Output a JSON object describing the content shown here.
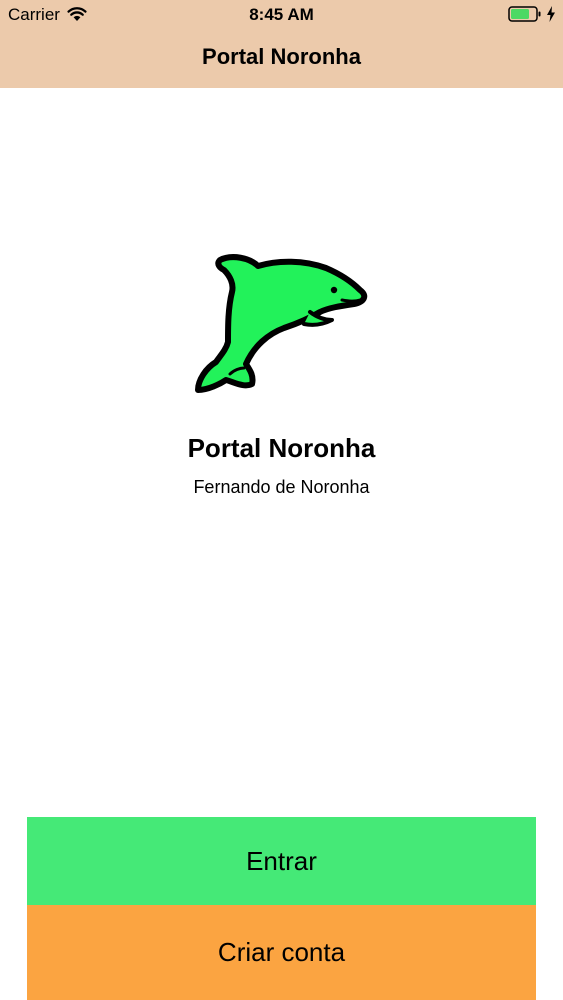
{
  "status_bar": {
    "carrier": "Carrier",
    "time": "8:45 AM",
    "icons": [
      "wifi-icon",
      "battery-icon",
      "charging-icon"
    ]
  },
  "nav": {
    "title": "Portal Noronha"
  },
  "main": {
    "logo_icon": "dolphin-logo",
    "title": "Portal Noronha",
    "subtitle": "Fernando de Noronha"
  },
  "actions": {
    "login_label": "Entrar",
    "signup_label": "Criar conta"
  },
  "colors": {
    "nav_background": "#ECCAAB",
    "login_button": "#45E977",
    "signup_button": "#FBA441",
    "dolphin_fill": "#22F25A",
    "battery_fill": "#4CD964"
  }
}
